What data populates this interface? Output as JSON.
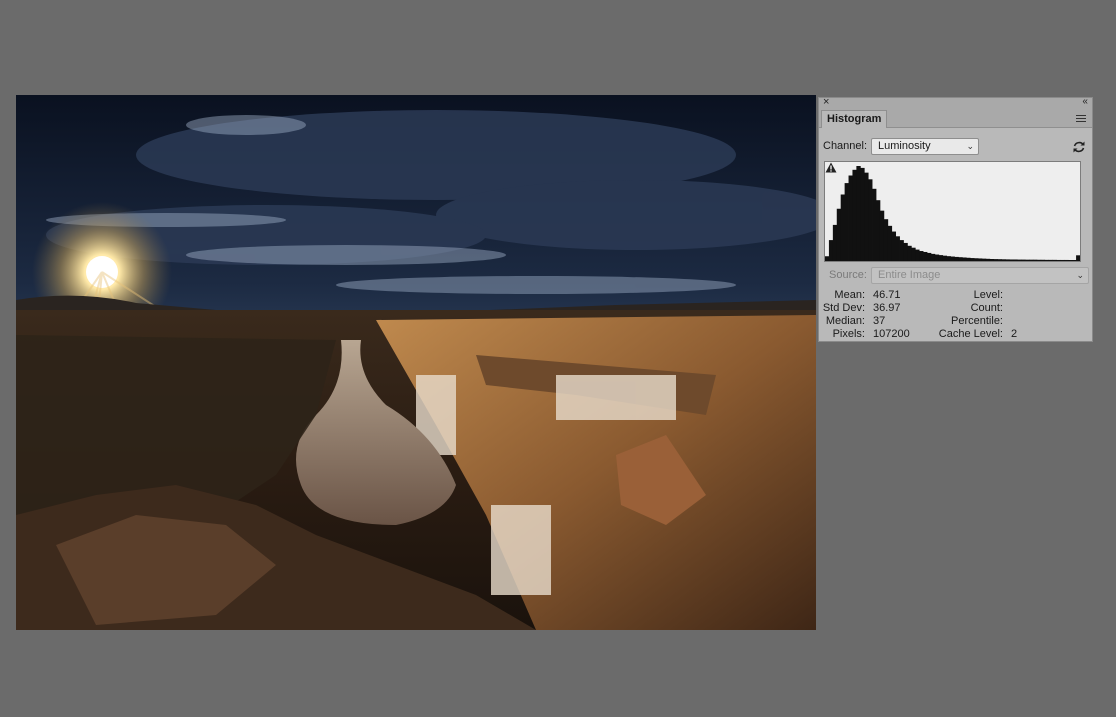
{
  "panel": {
    "tab_label": "Histogram",
    "close_glyph": "×",
    "collapse_glyph": "‹‹",
    "channel": {
      "label": "Channel:",
      "value": "Luminosity"
    },
    "source": {
      "label": "Source:",
      "value": "Entire Image"
    },
    "icons": [
      "close-icon",
      "collapse-icon",
      "panel-menu-icon",
      "refresh-icon",
      "cache-warning-icon",
      "chevron-down-icon"
    ],
    "stats": {
      "mean": {
        "label": "Mean:",
        "value": "46.71"
      },
      "std_dev": {
        "label": "Std Dev:",
        "value": "36.97"
      },
      "median": {
        "label": "Median:",
        "value": "37"
      },
      "pixels": {
        "label": "Pixels:",
        "value": "107200"
      },
      "level": {
        "label": "Level:",
        "value": ""
      },
      "count": {
        "label": "Count:",
        "value": ""
      },
      "percentile": {
        "label": "Percentile:",
        "value": ""
      },
      "cache_level": {
        "label": "Cache Level:",
        "value": "2"
      }
    },
    "histogram_shape": [
      0.05,
      0.22,
      0.38,
      0.55,
      0.7,
      0.82,
      0.9,
      0.96,
      1.0,
      0.98,
      0.93,
      0.86,
      0.76,
      0.64,
      0.53,
      0.44,
      0.37,
      0.31,
      0.26,
      0.22,
      0.19,
      0.16,
      0.14,
      0.12,
      0.105,
      0.095,
      0.085,
      0.075,
      0.068,
      0.062,
      0.056,
      0.051,
      0.047,
      0.043,
      0.04,
      0.037,
      0.034,
      0.031,
      0.029,
      0.027,
      0.025,
      0.023,
      0.021,
      0.02,
      0.019,
      0.018,
      0.017,
      0.016,
      0.016,
      0.015,
      0.015,
      0.014,
      0.014,
      0.014,
      0.013,
      0.013,
      0.012,
      0.012,
      0.012,
      0.011,
      0.011,
      0.011,
      0.01,
      0.01,
      0.06
    ]
  }
}
